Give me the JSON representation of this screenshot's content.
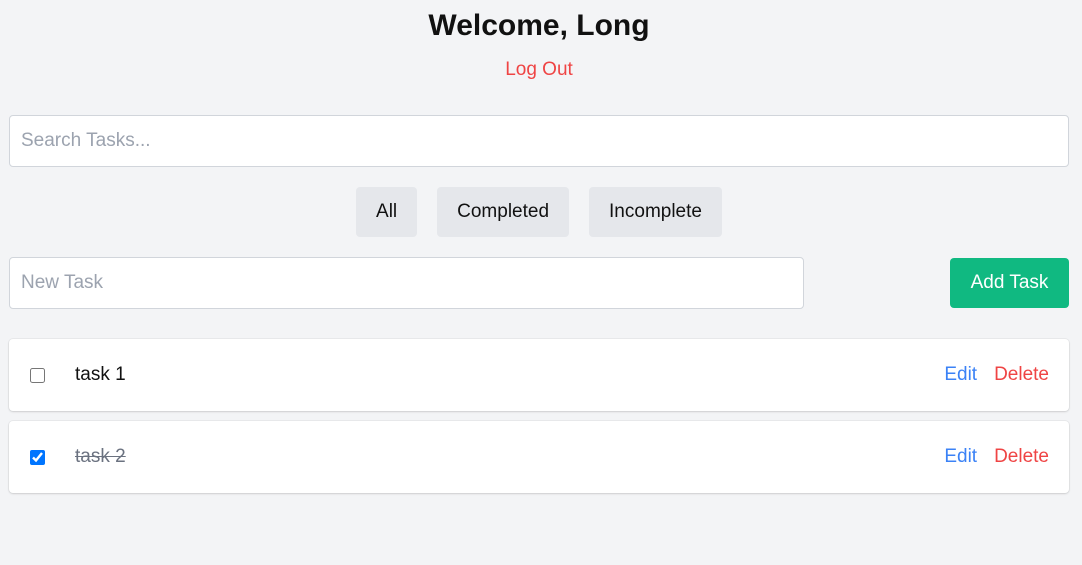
{
  "header": {
    "welcome": "Welcome, Long",
    "logout_label": "Log Out"
  },
  "search": {
    "placeholder": "Search Tasks...",
    "value": ""
  },
  "filters": [
    {
      "label": "All"
    },
    {
      "label": "Completed"
    },
    {
      "label": "Incomplete"
    }
  ],
  "new_task": {
    "placeholder": "New Task",
    "value": "",
    "add_label": "Add Task"
  },
  "tasks": [
    {
      "title": "task 1",
      "completed": false,
      "edit_label": "Edit",
      "delete_label": "Delete"
    },
    {
      "title": "task 2",
      "completed": true,
      "edit_label": "Edit",
      "delete_label": "Delete"
    }
  ],
  "colors": {
    "background": "#f3f4f6",
    "danger": "#ef4444",
    "link": "#3b82f6",
    "success": "#10b981",
    "filter_bg": "#e5e7eb"
  }
}
